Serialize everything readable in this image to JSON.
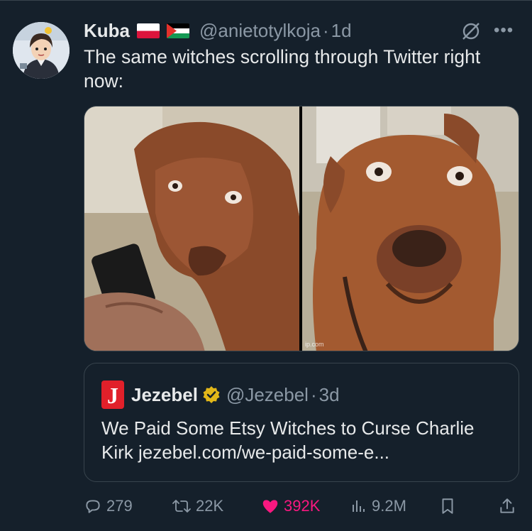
{
  "tweet": {
    "author_name": "Kuba",
    "handle": "@anietotylkoja",
    "separator": "·",
    "time": "1d",
    "more": "•••",
    "text": "The same witches scrolling through Twitter right now:",
    "watermark": "ip.com"
  },
  "quote": {
    "logo_letter": "J",
    "author_name": "Jezebel",
    "handle": "@Jezebel",
    "separator": "·",
    "time": "3d",
    "text": "We Paid Some Etsy Witches to Curse Charlie Kirk jezebel.com/we-paid-some-e..."
  },
  "actions": {
    "replies": "279",
    "retweets": "22K",
    "likes": "392K",
    "views": "9.2M"
  },
  "colors": {
    "background": "#15202b",
    "text": "#e7e9ea",
    "muted": "#8b98a5",
    "border": "#38444d",
    "like": "#f91880",
    "jezebel_red": "#e1202a",
    "verified_gold": "#e2b719"
  },
  "icons": {
    "reply": "reply-icon",
    "retweet": "retweet-icon",
    "like": "heart-icon",
    "views": "views-icon",
    "bookmark": "bookmark-icon",
    "share": "share-icon",
    "edit_indicator": "no-edit-icon",
    "more": "more-icon"
  }
}
